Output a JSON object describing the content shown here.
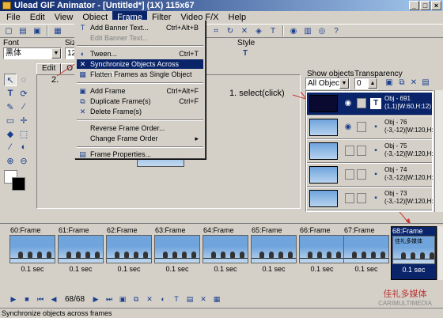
{
  "window": {
    "title": "Ulead GIF Animator - [Untitled*] (1X) 115x67"
  },
  "menubar": [
    "File",
    "Edit",
    "View",
    "Object",
    "Frame",
    "Filter",
    "Video F/X",
    "Help"
  ],
  "font_label": "Font",
  "font_value": "黑体",
  "size_label": "Siz",
  "size_value": "12",
  "style_label": "Style",
  "frame_menu": {
    "items": [
      {
        "label": "Add Banner Text...",
        "shortcut": "Ctrl+Alt+B",
        "icon": "T"
      },
      {
        "label": "Edit Banner Text...",
        "shortcut": "",
        "disabled": true
      },
      {
        "label": "Tween...",
        "shortcut": "Ctrl+T",
        "icon": "tween-icon"
      },
      {
        "label": "Synchronize Objects Across Frames...",
        "shortcut": "",
        "icon": "sync-icon",
        "highlighted": true
      },
      {
        "label": "Flatten Frames as Single Object",
        "shortcut": "",
        "icon": "flatten-icon"
      },
      {
        "label": "Add Frame",
        "shortcut": "Ctrl+Alt+F",
        "icon": "add-frame-icon"
      },
      {
        "label": "Duplicate Frame(s)",
        "shortcut": "Ctrl+F",
        "icon": "duplicate-icon"
      },
      {
        "label": "Delete Frame(s)",
        "shortcut": "",
        "icon": "delete-icon"
      },
      {
        "label": "Reverse Frame Order...",
        "shortcut": ""
      },
      {
        "label": "Change Frame Order",
        "shortcut": ""
      },
      {
        "label": "Frame Properties...",
        "shortcut": "",
        "icon": "properties-icon"
      }
    ]
  },
  "canvas_tabs": [
    "Edit",
    "O"
  ],
  "annotations": {
    "step1": "1. select(click)",
    "step2": "2."
  },
  "object_panel": {
    "show_objects_label": "Show objects",
    "transparency_label": "Transparency",
    "show_objects_value": "All Objects",
    "transparency_value": "0",
    "rows": [
      {
        "name": "Obj - 691",
        "coords": "(1,1)[W:60,H:12)",
        "selected": true,
        "type": "T"
      },
      {
        "name": "Obj - 76",
        "coords": "(-3,-12)[W:120,H:5"
      },
      {
        "name": "Obj - 75",
        "coords": "(-3,-12)[W:120,H:5"
      },
      {
        "name": "Obj - 74",
        "coords": "(-3,-12)[W:120,H:5"
      },
      {
        "name": "Obj - 73",
        "coords": "(-3,-12)[W:120,H:5"
      }
    ]
  },
  "frames": [
    {
      "label": "60:Frame",
      "delay": "0.1 sec"
    },
    {
      "label": "61:Frame",
      "delay": "0.1 sec"
    },
    {
      "label": "62:Frame",
      "delay": "0.1 sec"
    },
    {
      "label": "63:Frame",
      "delay": "0.1 sec"
    },
    {
      "label": "64:Frame",
      "delay": "0.1 sec"
    },
    {
      "label": "65:Frame",
      "delay": "0.1 sec"
    },
    {
      "label": "66:Frame",
      "delay": "0.1 sec"
    },
    {
      "label": "67:Frame",
      "delay": "0.1 sec"
    },
    {
      "label": "68:Frame",
      "delay": "0.1 sec",
      "selected": true,
      "text": "佳礼多媒体"
    }
  ],
  "controls": {
    "frame_counter": "68/68"
  },
  "status": "Synchronize objects across frames",
  "watermark": {
    "cn": "佳礼多媒体",
    "en": "CARIMULTIMEDIA"
  }
}
